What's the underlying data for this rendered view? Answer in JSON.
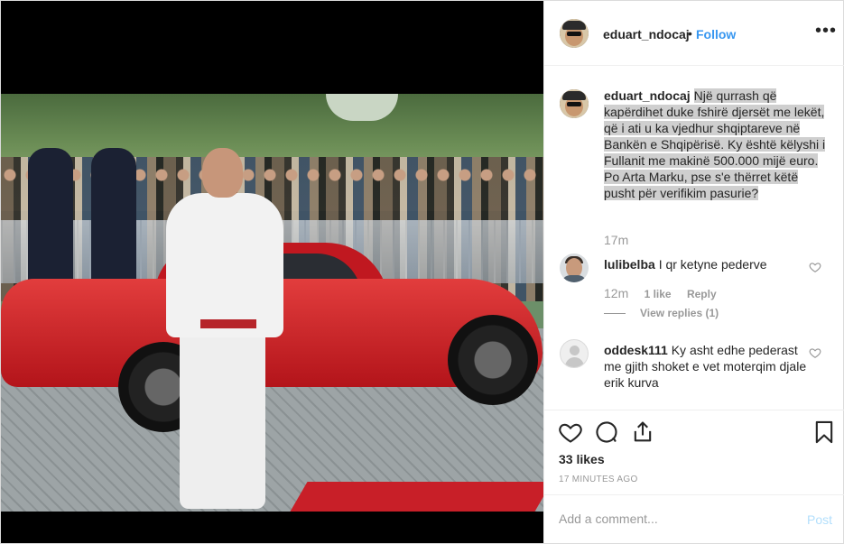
{
  "post": {
    "username": "eduart_ndocaj",
    "separator": "•",
    "follow_label": "Follow",
    "more_label": "•••"
  },
  "caption": {
    "username": "eduart_ndocaj",
    "text": "Një qurrash që kapërdihet duke fshirë djersët me lekët, që i ati u ka vjedhur shqiptareve në Bankën e Shqipërisë. Ky është këlyshi i Fullanit me makinë 500.000 mijë euro. Po Arta Marku, pse s'e thërret këtë pusht për verifikim pasurie?",
    "time": "17m"
  },
  "comments": [
    {
      "username": "lulibelba",
      "text": "I qr ketyne pederve",
      "time": "12m",
      "likes": "1 like",
      "reply_label": "Reply",
      "view_replies": "View replies (1)"
    },
    {
      "username": "oddesk111",
      "text": "Ky asht edhe pederast me gjith shoket e vet moterqim djale erik kurva"
    }
  ],
  "actions": {
    "likes_count": "33 likes",
    "time_ago": "17 MINUTES AGO"
  },
  "add_comment": {
    "placeholder": "Add a comment...",
    "post_label": "Post"
  },
  "colors": {
    "link_blue": "#3897f0",
    "post_disabled": "#b2dffc",
    "muted_text": "#999999",
    "border": "#efefef"
  },
  "icons": {
    "like": "heart-icon",
    "comment": "comment-icon",
    "share": "share-icon",
    "save": "bookmark-icon",
    "options": "more-options-icon"
  }
}
